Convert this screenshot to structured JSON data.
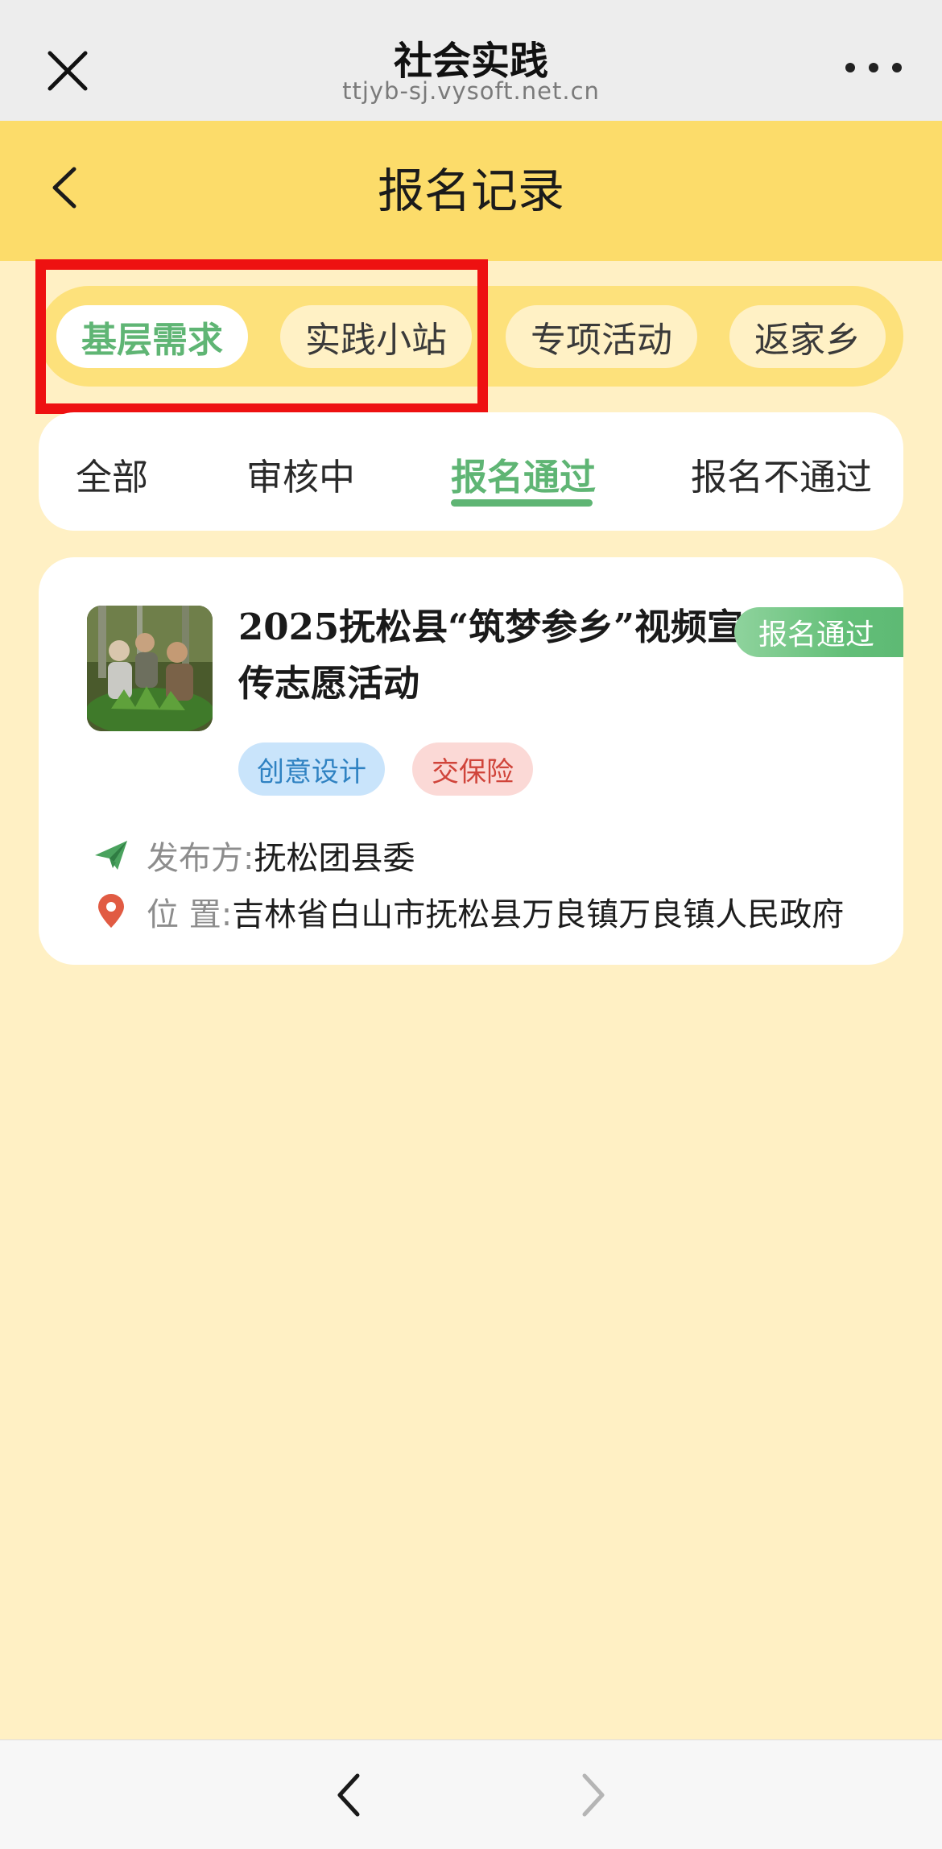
{
  "wechat_bar": {
    "title": "社会实践",
    "url": "ttjyb-sj.vysoft.net.cn",
    "close_icon": "close-icon",
    "more_icon": "more-icon"
  },
  "header": {
    "title": "报名记录",
    "back_icon": "chevron-left-icon",
    "background": "#fcdc6a"
  },
  "categories": [
    {
      "label": "基层需求",
      "active": true
    },
    {
      "label": "实践小站",
      "active": false
    },
    {
      "label": "专项活动",
      "active": false
    },
    {
      "label": "返家乡",
      "active": false
    }
  ],
  "status_tabs": [
    {
      "label": "全部",
      "active": false
    },
    {
      "label": "审核中",
      "active": false
    },
    {
      "label": "报名通过",
      "active": true
    },
    {
      "label": "报名不通过",
      "active": false
    }
  ],
  "records": [
    {
      "title": "2025抚松县“筑梦参乡”视频宣传志愿活动",
      "status": "报名通过",
      "tags": [
        "创意设计",
        "交保险"
      ],
      "publisher_label": "发布方:",
      "publisher": "抚松团县委",
      "location_label": "位 置:",
      "location": "吉林省白山市抚松县万良镇万良镇人民政府"
    }
  ],
  "bottom_nav": {
    "back_icon": "chevron-left-icon",
    "forward_icon": "chevron-right-icon"
  },
  "colors": {
    "accent_green": "#5fb574",
    "page_background": "#fff0c4",
    "highlight_red": "#ee1111"
  }
}
